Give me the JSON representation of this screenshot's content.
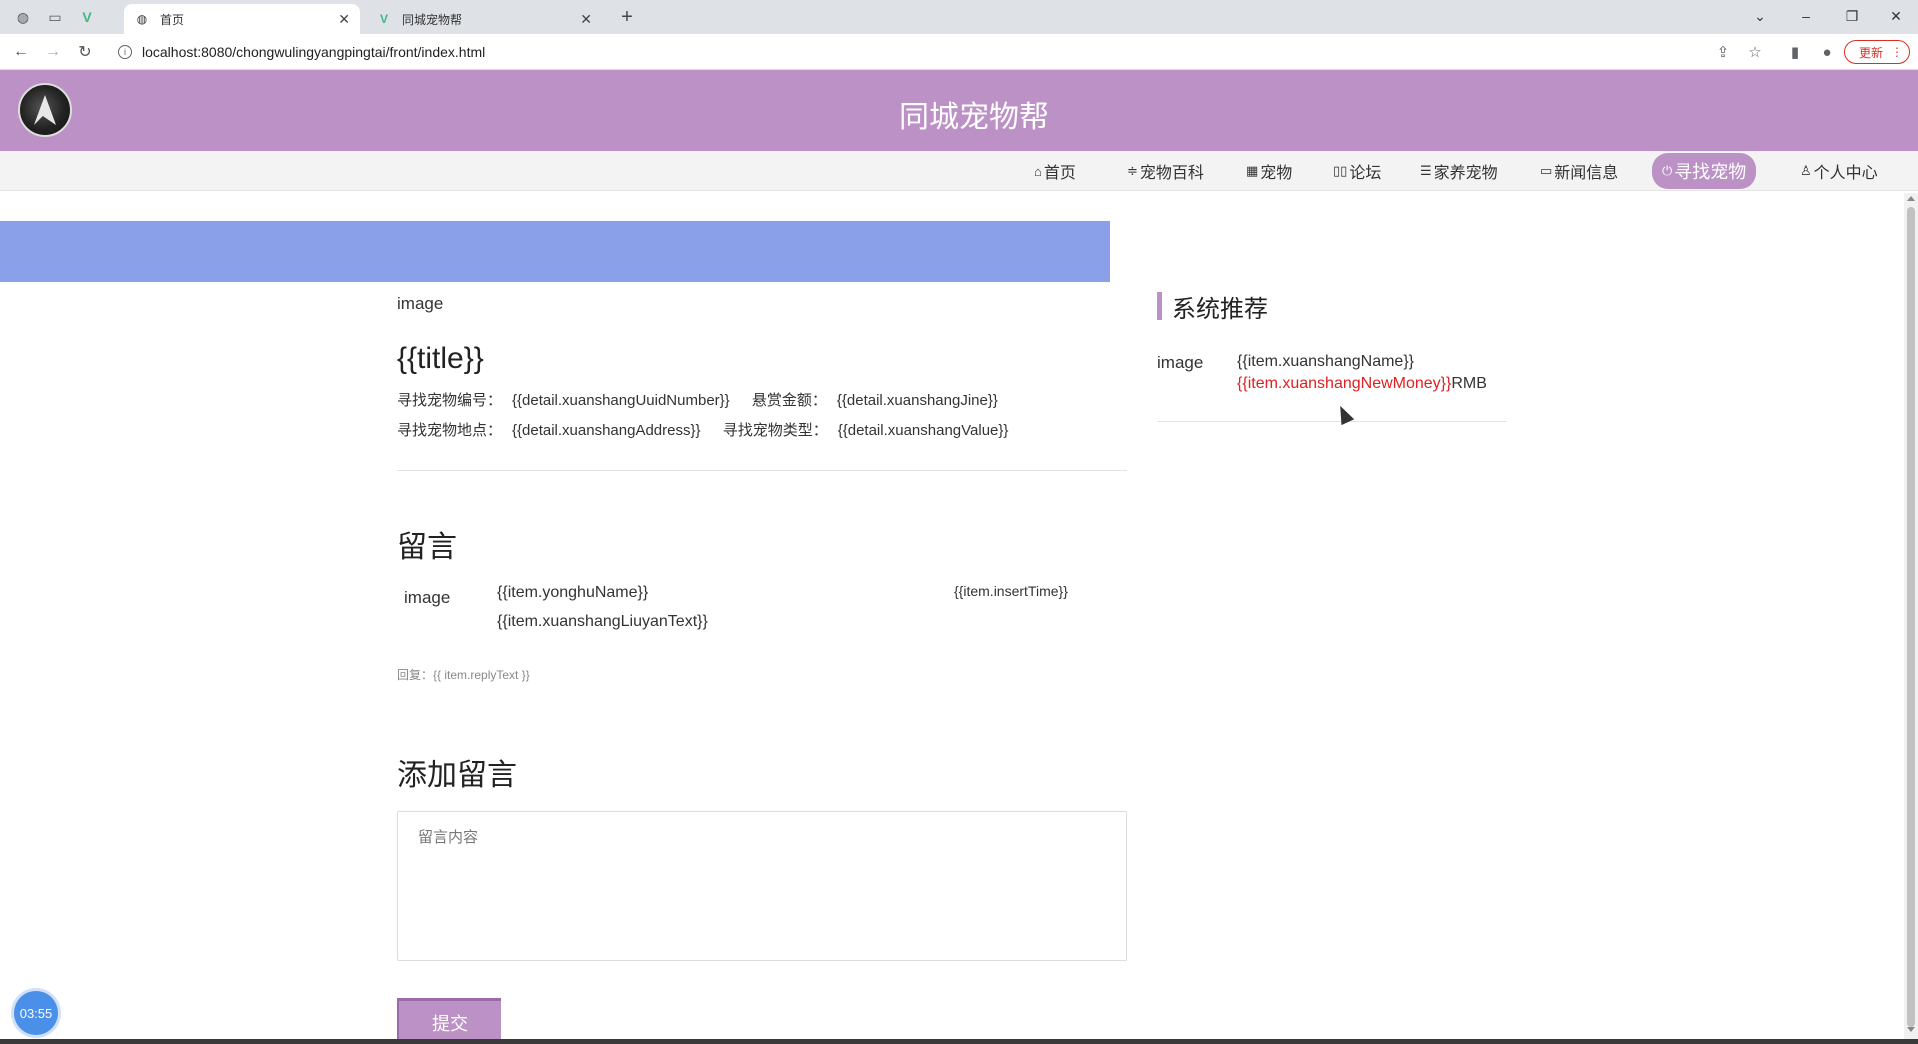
{
  "browser": {
    "tabs": [
      {
        "label": "首页",
        "active": true
      },
      {
        "label": "同城宠物帮",
        "active": false
      }
    ],
    "url": "localhost:8080/chongwulingyangpingtai/front/index.html",
    "update_label": "更新"
  },
  "site": {
    "title": "同城宠物帮",
    "nav": [
      {
        "label": "首页",
        "icon": "home-icon"
      },
      {
        "label": "宠物百科",
        "icon": "sliders-icon"
      },
      {
        "label": "宠物",
        "icon": "grid-icon"
      },
      {
        "label": "论坛",
        "icon": "forum-icon"
      },
      {
        "label": "家养宠物",
        "icon": "layers-icon"
      },
      {
        "label": "新闻信息",
        "icon": "book-icon"
      },
      {
        "label": "寻找宠物",
        "icon": "power-icon",
        "active": true
      },
      {
        "label": "个人中心",
        "icon": "user-icon"
      }
    ]
  },
  "detail": {
    "image_alt": "image",
    "title": "{{title}}",
    "number_label": "寻找宠物编号：",
    "number_value": "{{detail.xuanshangUuidNumber}}",
    "reward_label": "悬赏金额：",
    "reward_value": "{{detail.xuanshangJine}}",
    "address_label": "寻找宠物地点：",
    "address_value": "{{detail.xuanshangAddress}}",
    "type_label": "寻找宠物类型：",
    "type_value": "{{detail.xuanshangValue}}"
  },
  "comments": {
    "heading": "留言",
    "avatar_alt": "image",
    "name": "{{item.yonghuName}}",
    "text": "{{item.xuanshangLiuyanText}}",
    "time": "{{item.insertTime}}",
    "reply": "回复：{{ item.replyText }}"
  },
  "add_comment": {
    "heading": "添加留言",
    "placeholder": "留言内容",
    "submit_label": "提交"
  },
  "sidebar": {
    "heading": "系统推荐",
    "image_alt": "image",
    "name": "{{item.xuanshangName}}",
    "money": "{{item.xuanshangNewMoney}}",
    "unit": "RMB"
  },
  "timer": "03:55",
  "colors": {
    "header": "#bc92c6",
    "banner": "#8aa0e8",
    "money": "#e02020"
  }
}
